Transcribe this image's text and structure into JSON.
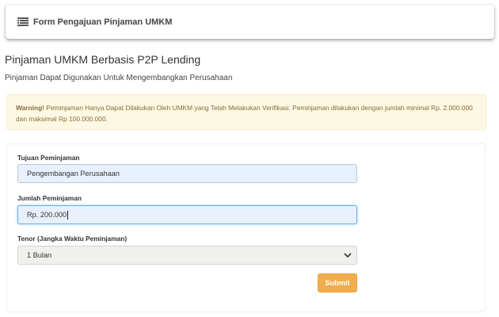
{
  "topbar": {
    "title": "Form Pengajuan Pinjaman UMKM",
    "icon": "menu-list-icon"
  },
  "page": {
    "heading": "Pinjaman UMKM Berbasis P2P Lending",
    "subheading": "Pinjaman Dapat Digunakan Untuk Mengembangkan Perusahaan"
  },
  "alert": {
    "strong": "Warning!",
    "text": " Peminjaman Hanya Dapat Dilakukan Oleh UMKM yang Telah Melakukan Verifikasi. Peminjaman dilakukan dengan jumlah minimal Rp. 2.000.000 dan maksimal Rp 100.000.000.",
    "color": "#8a6d3b",
    "background": "#fcf8e3"
  },
  "form": {
    "purpose_label": "Tujuan Peminjaman",
    "purpose_value": "Pengembangan Perusahaan",
    "amount_label": "Jumlah Peminjaman",
    "amount_value": "Rp. 200.000",
    "tenor_label": "Tenor (Jangka Waktu Peminjaman)",
    "tenor_selected": "1 Bulan",
    "submit_label": "Submit",
    "submit_color": "#f0ad4e"
  }
}
